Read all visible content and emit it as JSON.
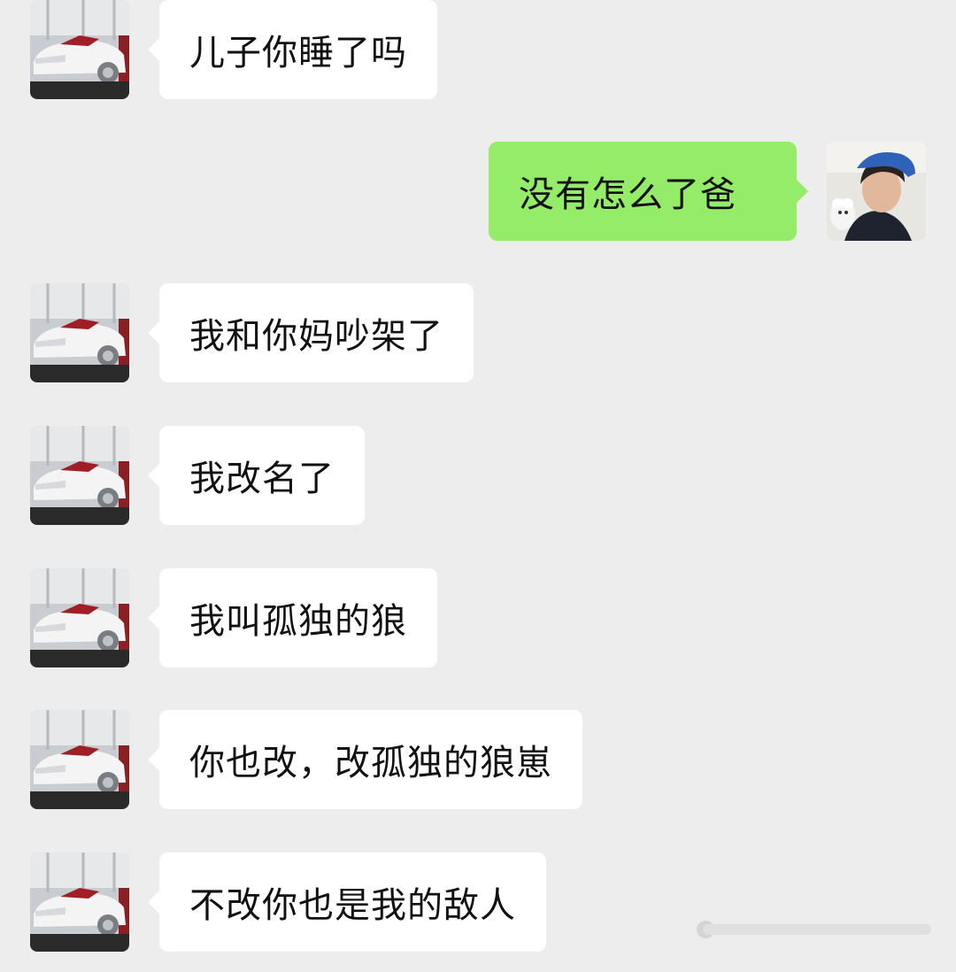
{
  "messages": [
    {
      "from": "father",
      "text": "儿子你睡了吗"
    },
    {
      "from": "me",
      "text": "没有怎么了爸"
    },
    {
      "from": "father",
      "text": "我和你妈吵架了"
    },
    {
      "from": "father",
      "text": "我改名了"
    },
    {
      "from": "father",
      "text": "我叫孤独的狼"
    },
    {
      "from": "father",
      "text": "你也改，改孤独的狼崽"
    },
    {
      "from": "father",
      "text": "不改你也是我的敌人"
    }
  ],
  "avatars": {
    "father": "white-sports-car-avatar",
    "me": "young-man-blue-cap-avatar"
  },
  "colors": {
    "background": "#ededed",
    "incoming_bubble": "#ffffff",
    "outgoing_bubble": "#95ec69",
    "text": "#111111"
  }
}
